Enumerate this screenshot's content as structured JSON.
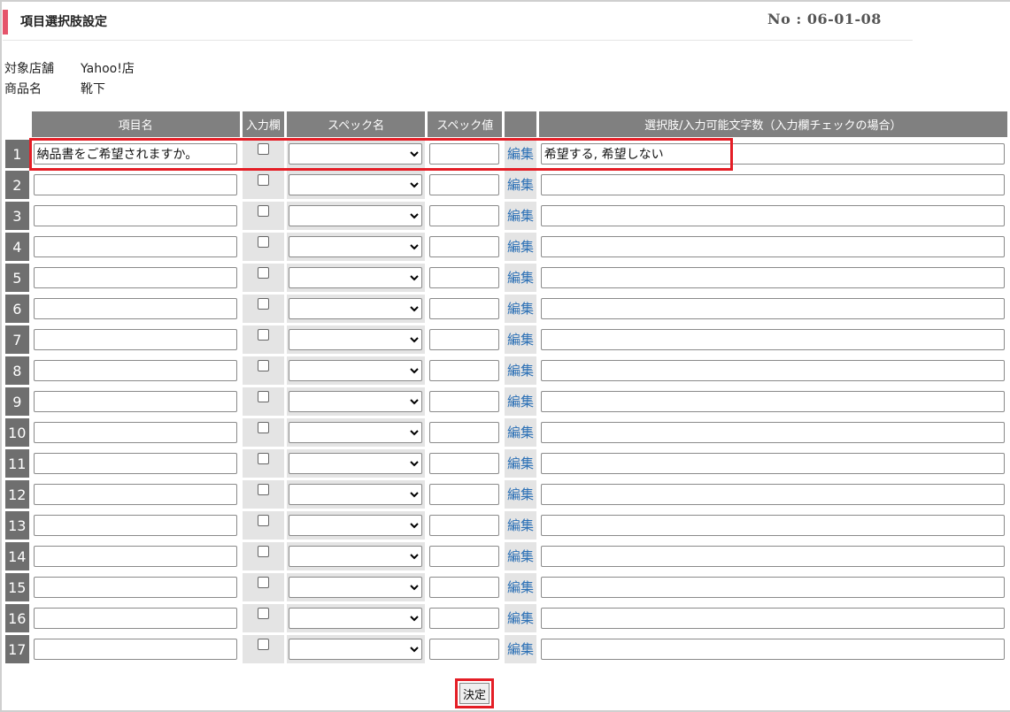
{
  "header": {
    "title": "項目選択肢設定",
    "page_no": "No : 06-01-08"
  },
  "info": {
    "store_label": "対象店舗",
    "store_value": "Yahoo!店",
    "product_label": "商品名",
    "product_value": "靴下"
  },
  "table": {
    "headers": {
      "item_name": "項目名",
      "input_field": "入力欄",
      "spec_name": "スペック名",
      "spec_value": "スペック値",
      "edit": "",
      "choices": "選択肢/入力可能文字数（入力欄チェックの場合）"
    },
    "edit_label": "編集",
    "rows": [
      {
        "num": "1",
        "item_name": "納品書をご希望されますか。",
        "input_checked": false,
        "spec_name": "",
        "spec_value": "",
        "choices": "希望する, 希望しない"
      },
      {
        "num": "2",
        "item_name": "",
        "input_checked": false,
        "spec_name": "",
        "spec_value": "",
        "choices": ""
      },
      {
        "num": "3",
        "item_name": "",
        "input_checked": false,
        "spec_name": "",
        "spec_value": "",
        "choices": ""
      },
      {
        "num": "4",
        "item_name": "",
        "input_checked": false,
        "spec_name": "",
        "spec_value": "",
        "choices": ""
      },
      {
        "num": "5",
        "item_name": "",
        "input_checked": false,
        "spec_name": "",
        "spec_value": "",
        "choices": ""
      },
      {
        "num": "6",
        "item_name": "",
        "input_checked": false,
        "spec_name": "",
        "spec_value": "",
        "choices": ""
      },
      {
        "num": "7",
        "item_name": "",
        "input_checked": false,
        "spec_name": "",
        "spec_value": "",
        "choices": ""
      },
      {
        "num": "8",
        "item_name": "",
        "input_checked": false,
        "spec_name": "",
        "spec_value": "",
        "choices": ""
      },
      {
        "num": "9",
        "item_name": "",
        "input_checked": false,
        "spec_name": "",
        "spec_value": "",
        "choices": ""
      },
      {
        "num": "10",
        "item_name": "",
        "input_checked": false,
        "spec_name": "",
        "spec_value": "",
        "choices": ""
      },
      {
        "num": "11",
        "item_name": "",
        "input_checked": false,
        "spec_name": "",
        "spec_value": "",
        "choices": ""
      },
      {
        "num": "12",
        "item_name": "",
        "input_checked": false,
        "spec_name": "",
        "spec_value": "",
        "choices": ""
      },
      {
        "num": "13",
        "item_name": "",
        "input_checked": false,
        "spec_name": "",
        "spec_value": "",
        "choices": ""
      },
      {
        "num": "14",
        "item_name": "",
        "input_checked": false,
        "spec_name": "",
        "spec_value": "",
        "choices": ""
      },
      {
        "num": "15",
        "item_name": "",
        "input_checked": false,
        "spec_name": "",
        "spec_value": "",
        "choices": ""
      },
      {
        "num": "16",
        "item_name": "",
        "input_checked": false,
        "spec_name": "",
        "spec_value": "",
        "choices": ""
      },
      {
        "num": "17",
        "item_name": "",
        "input_checked": false,
        "spec_name": "",
        "spec_value": "",
        "choices": ""
      }
    ]
  },
  "submit_label": "決定",
  "colors": {
    "accent": "#e5546b",
    "highlight": "#e41e26",
    "header_bg": "#808080",
    "link": "#2a6fb5"
  }
}
